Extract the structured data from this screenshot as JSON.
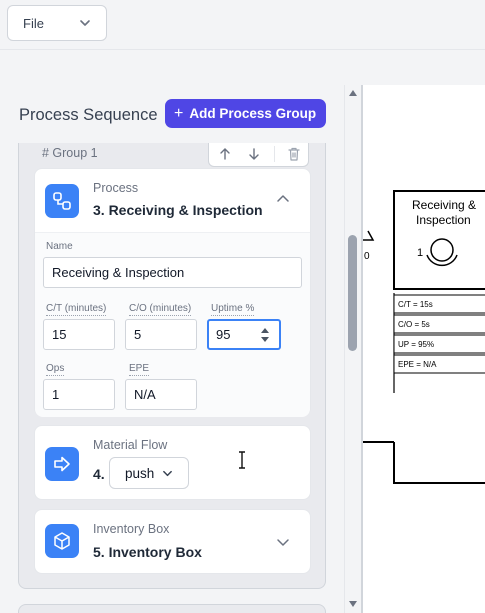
{
  "menu": {
    "file_label": "File"
  },
  "panel": {
    "title": "Process Sequence",
    "add_button": "Add Process Group",
    "group_label": "# Group 1"
  },
  "process_card": {
    "kicker": "Process",
    "name": "3. Receiving & Inspection",
    "fields": {
      "name_label": "Name",
      "name_value": "Receiving & Inspection",
      "ct_label": "C/T (minutes)",
      "ct_value": "15",
      "co_label": "C/O (minutes)",
      "co_value": "5",
      "uptime_label": "Uptime %",
      "uptime_value": "95",
      "ops_label": "Ops",
      "ops_value": "1",
      "epe_label": "EPE",
      "epe_value": "N/A"
    }
  },
  "flow_card": {
    "kicker": "Material Flow",
    "number": "4.",
    "select_value": "push"
  },
  "inventory_card": {
    "kicker": "Inventory Box",
    "name": "5. Inventory Box"
  },
  "diagram": {
    "process_title_line1": "Receiving &",
    "process_title_line2": "Inspection",
    "operator_count": "1",
    "side_number": "0",
    "data_rows": [
      "C/T = 15s",
      "C/O = 5s",
      "UP = 95%",
      "EPE = N/A"
    ]
  },
  "colors": {
    "accent": "#4f46e5",
    "icon_tile": "#3b82f6",
    "focus": "#3b82f6"
  }
}
